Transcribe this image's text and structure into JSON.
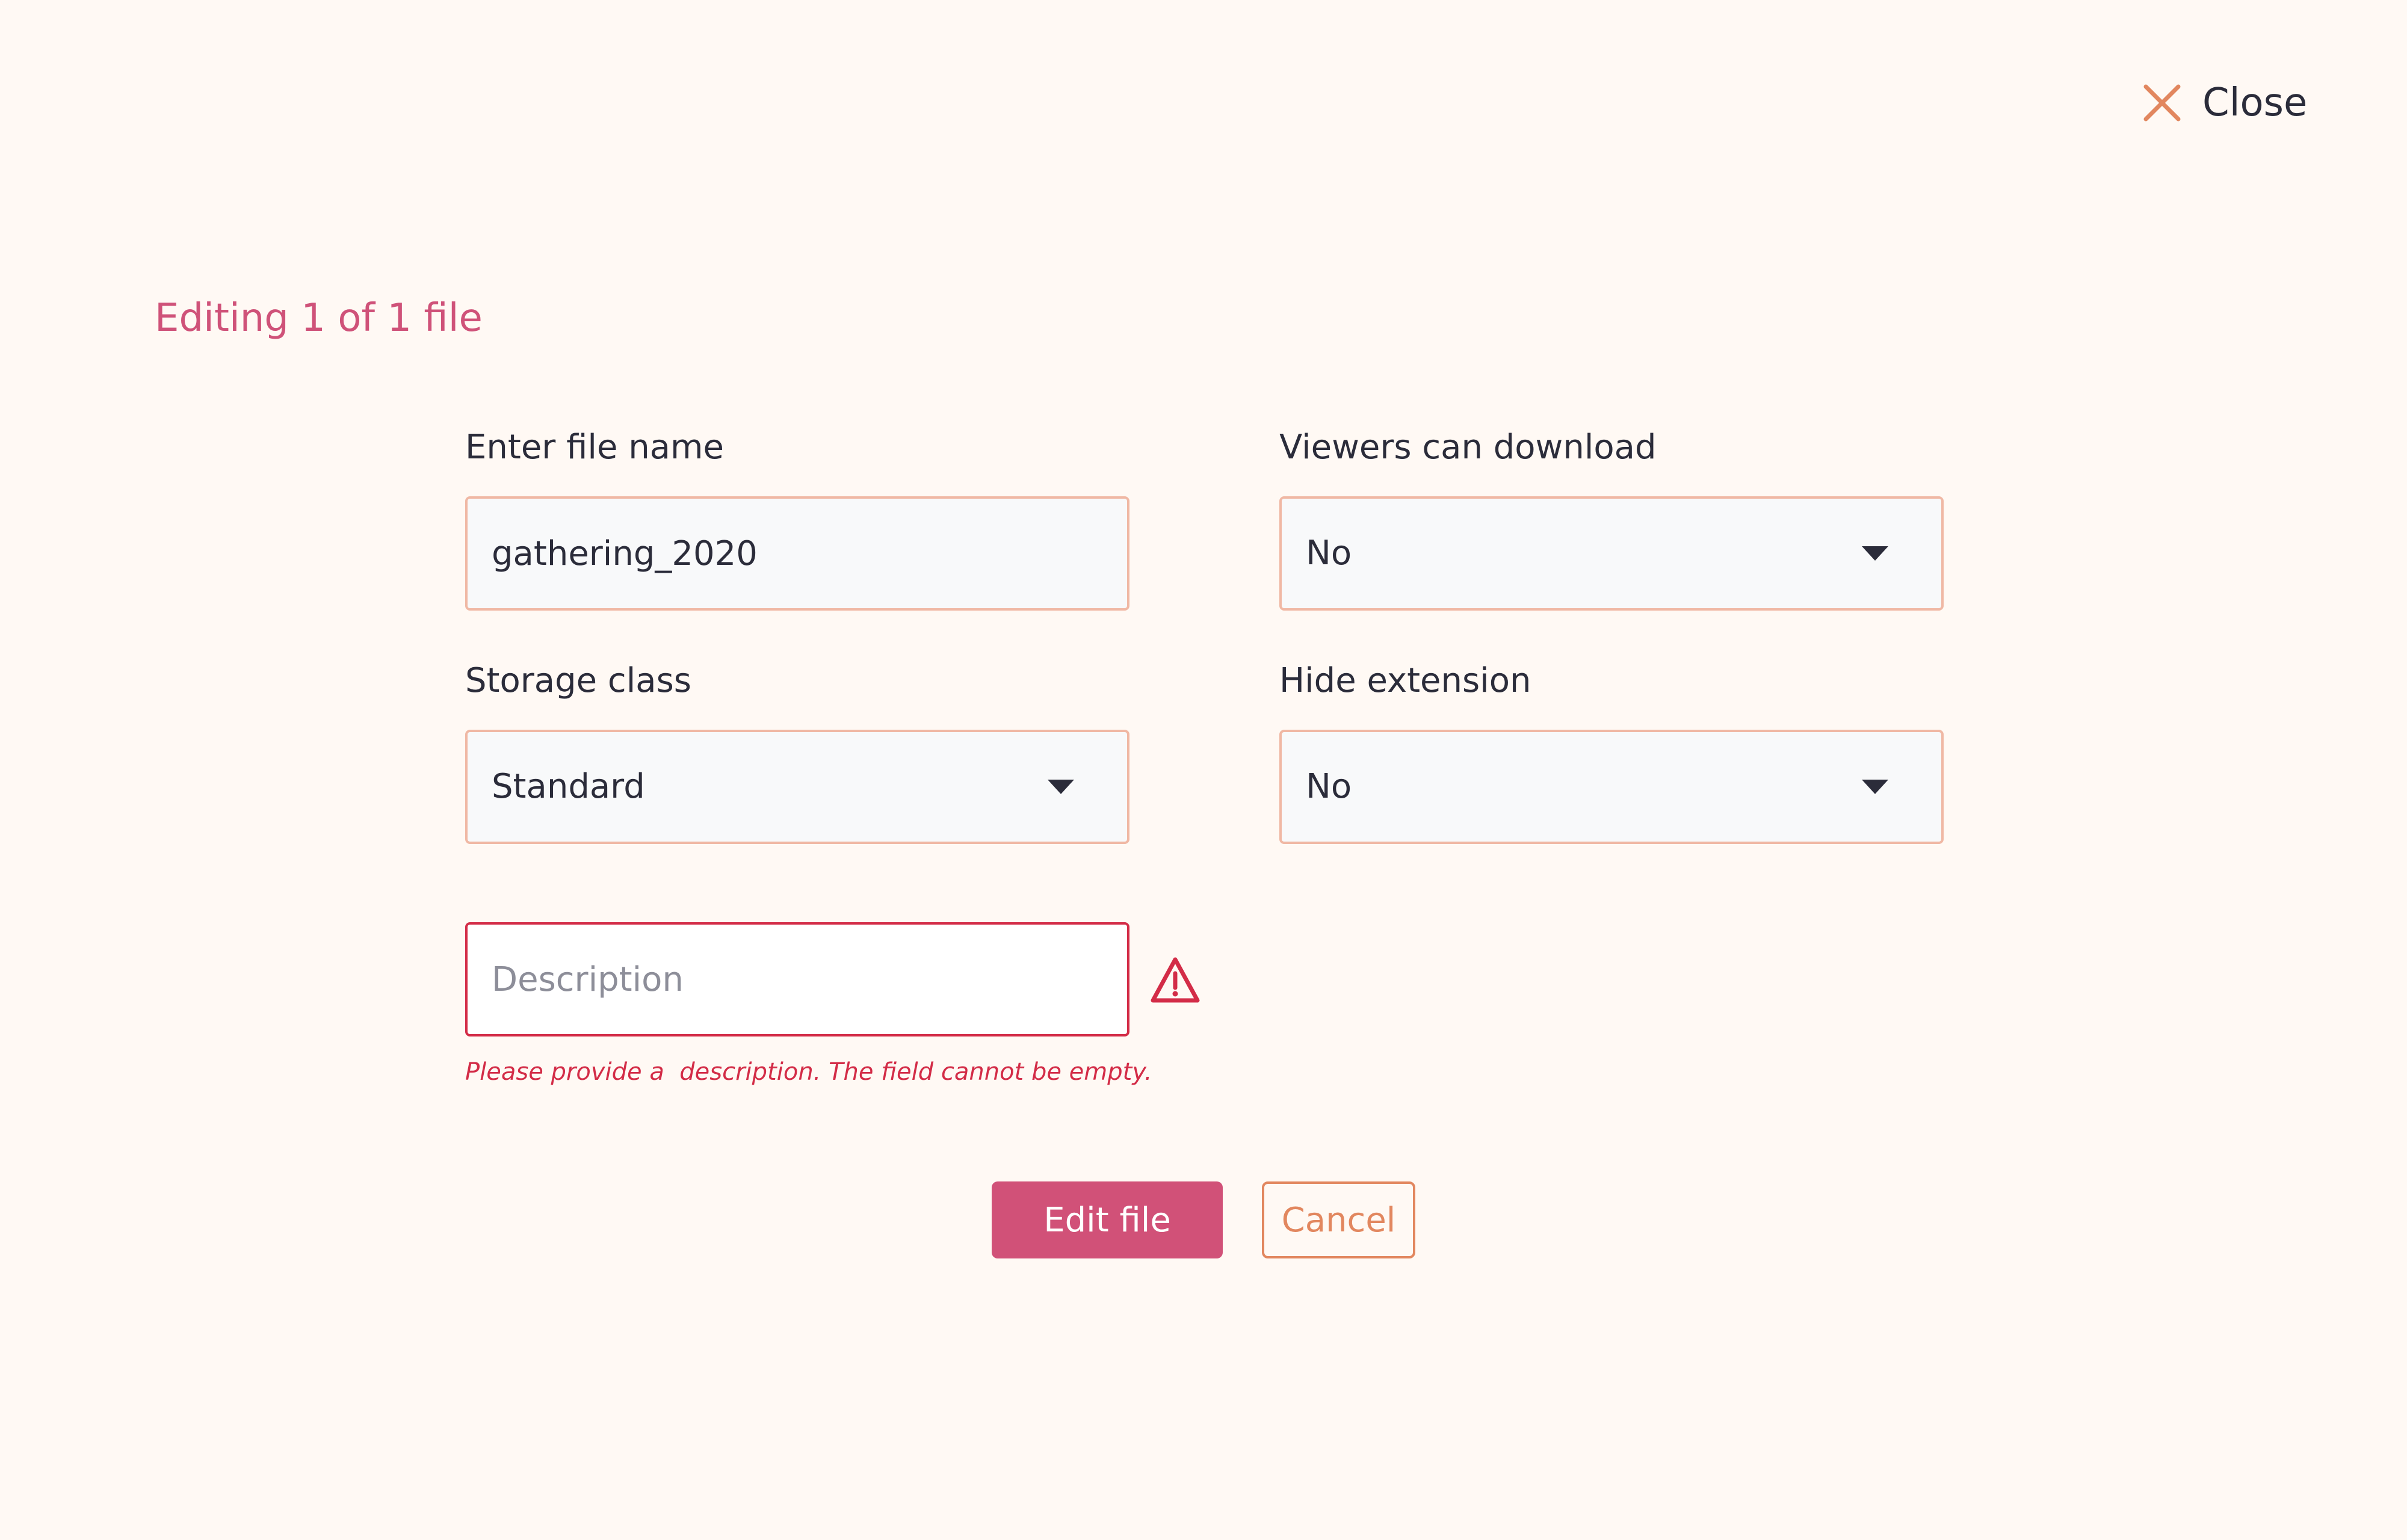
{
  "header": {
    "close_label": "Close",
    "close_icon": "close-icon"
  },
  "title": "Editing 1 of 1 file",
  "form": {
    "file_name": {
      "label": "Enter file name",
      "value": "gathering_2020"
    },
    "viewers_can_download": {
      "label": "Viewers can download",
      "selected": "No"
    },
    "storage_class": {
      "label": "Storage class",
      "selected": "Standard"
    },
    "hide_extension": {
      "label": "Hide extension",
      "selected": "No"
    },
    "description": {
      "placeholder": "Description",
      "value": "",
      "error": "Please provide a  description. The field cannot be empty.",
      "error_icon": "warning-icon"
    }
  },
  "actions": {
    "submit_label": "Edit file",
    "cancel_label": "Cancel"
  },
  "colors": {
    "background": "#fff9f4",
    "accent": "#cf5279",
    "secondary": "#e2875f",
    "error": "#d32c47",
    "input_border": "#f0b8a4"
  }
}
